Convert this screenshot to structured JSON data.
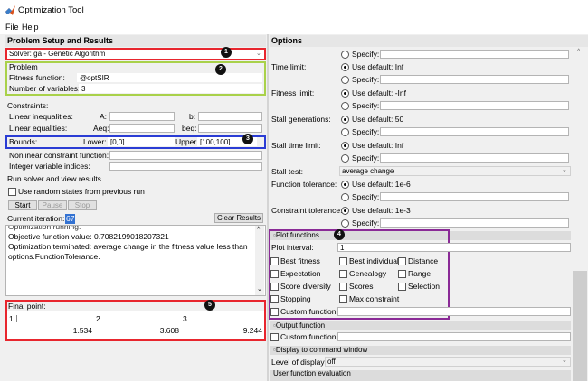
{
  "window": {
    "title": "Optimization Tool"
  },
  "menu": [
    "File",
    "Help"
  ],
  "left_panel": {
    "header": "Problem Setup and Results",
    "solver": "Solver: ga - Genetic Algorithm",
    "problem": {
      "title": "Problem",
      "fitness_label": "Fitness function:",
      "fitness_value": "@optSIR",
      "nvars_label": "Number of variables:",
      "nvars_value": "3"
    },
    "constraints": {
      "title": "Constraints:",
      "linear_ineq": "Linear inequalities:",
      "A": "A:",
      "b": "b:",
      "linear_eq": "Linear equalities:",
      "Aeq": "Aeq:",
      "beq": "beq:",
      "bounds": "Bounds:",
      "lower_label": "Lower:",
      "lower_value": "[0,0]",
      "upper_label": "Upper:",
      "upper_value": "[100,100]",
      "nonlinear": "Nonlinear constraint function:",
      "integer": "Integer variable indices:"
    },
    "run": {
      "title": "Run solver and view results",
      "random_states": "Use random states from previous run",
      "start": "Start",
      "pause": "Pause",
      "stop": "Stop",
      "current_iteration_label": "Current iteration:",
      "current_iteration_value": "67",
      "clear_results": "Clear Results"
    },
    "results": {
      "line0": "Optimization running.",
      "line1": "Objective function value: 0.7082199018207321",
      "line2": "Optimization terminated: average change in the fitness value less than",
      "line3": "options.FunctionTolerance."
    },
    "final_point": {
      "label": "Final point:",
      "headers": [
        "1",
        "2",
        "3"
      ],
      "values": [
        "1.534",
        "3.608",
        "9.244"
      ]
    },
    "badges": [
      "1",
      "2",
      "3",
      "5"
    ]
  },
  "options": {
    "header": "Options",
    "specify": "Specify:",
    "use_default_prefix": "Use default:",
    "time_limit": {
      "label": "Time limit:",
      "default": "Use default: Inf"
    },
    "fitness_limit": {
      "label": "Fitness limit:",
      "default": "Use default: -Inf"
    },
    "stall_generations": {
      "label": "Stall generations:",
      "default": "Use default: 50"
    },
    "stall_time_limit": {
      "label": "Stall time limit:",
      "default": "Use default: Inf"
    },
    "stall_test": {
      "label": "Stall test:",
      "value": "average change"
    },
    "function_tolerance": {
      "label": "Function tolerance:",
      "default": "Use default: 1e-6"
    },
    "constraint_tolerance": {
      "label": "Constraint tolerance:",
      "default": "Use default: 1e-3"
    },
    "plot_functions": {
      "section": "Plot functions",
      "badge": "4",
      "interval_label": "Plot interval:",
      "interval_value": "1",
      "items": [
        "Best fitness",
        "Best individual",
        "Distance",
        "Expectation",
        "Genealogy",
        "Range",
        "Score diversity",
        "Scores",
        "Selection",
        "Stopping",
        "Max constraint"
      ],
      "custom": "Custom function:"
    },
    "output_function": {
      "section": "Output function",
      "custom": "Custom function:"
    },
    "display": {
      "section": "Display to command window",
      "level_label": "Level of display:",
      "level_value": "off"
    },
    "user_eval": {
      "section": "User function evaluation"
    }
  }
}
